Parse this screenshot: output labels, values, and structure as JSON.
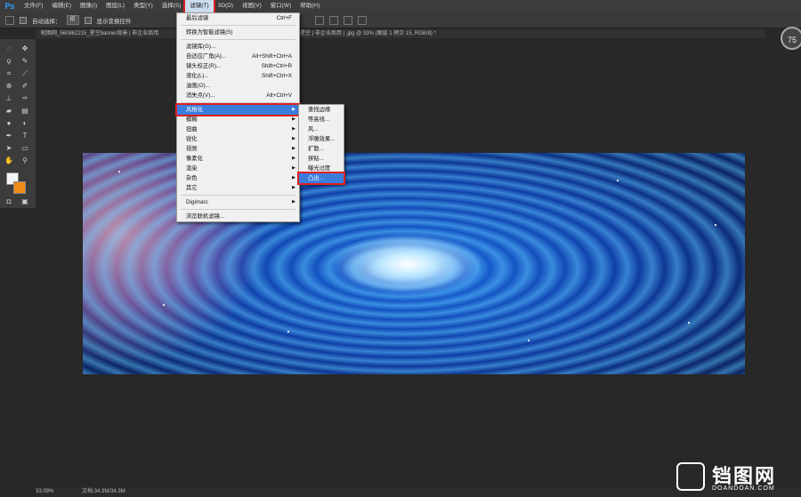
{
  "menubar": {
    "logo": "Ps",
    "items": [
      {
        "label": "文件(F)"
      },
      {
        "label": "编辑(E)"
      },
      {
        "label": "图像(I)"
      },
      {
        "label": "图层(L)"
      },
      {
        "label": "类型(Y)"
      },
      {
        "label": "选择(S)"
      },
      {
        "label": "滤镜(T)",
        "active": true
      },
      {
        "label": "3D(D)"
      },
      {
        "label": "视图(V)"
      },
      {
        "label": "窗口(W)"
      },
      {
        "label": "帮助(H)"
      }
    ]
  },
  "options": {
    "auto_select_label": "自动选择：",
    "auto_select_value": "组",
    "show_transform_label": "显示变换控件"
  },
  "document_tab": {
    "left_title": "昵图网_560862215_星空banner背景 | 非企业商用",
    "right_title": "梦幻星空 | 非企业商用 | .jpg @ 33% (图层 1 拷贝 15, RGB/8) *"
  },
  "zoom_badge": "75",
  "filter_menu": {
    "items": [
      {
        "label": "最后滤镜",
        "shortcut": "Ctrl+F"
      },
      {
        "sep": true
      },
      {
        "label": "转换为智能滤镜(S)"
      },
      {
        "sep": true
      },
      {
        "label": "滤镜库(G)..."
      },
      {
        "label": "自适应广角(A)...",
        "shortcut": "Alt+Shift+Ctrl+A"
      },
      {
        "label": "镜头校正(R)...",
        "shortcut": "Shift+Ctrl+R"
      },
      {
        "label": "液化(L)...",
        "shortcut": "Shift+Ctrl+X"
      },
      {
        "label": "油画(O)..."
      },
      {
        "label": "消失点(V)...",
        "shortcut": "Alt+Ctrl+V"
      },
      {
        "sep": true
      },
      {
        "label": "风格化",
        "submenu": true,
        "highlighted": true
      },
      {
        "label": "模糊",
        "submenu": true
      },
      {
        "label": "扭曲",
        "submenu": true
      },
      {
        "label": "锐化",
        "submenu": true
      },
      {
        "label": "视频",
        "submenu": true
      },
      {
        "label": "像素化",
        "submenu": true
      },
      {
        "label": "渲染",
        "submenu": true
      },
      {
        "label": "杂色",
        "submenu": true
      },
      {
        "label": "其它",
        "submenu": true
      },
      {
        "sep": true
      },
      {
        "label": "Digimarc",
        "submenu": true
      },
      {
        "sep": true
      },
      {
        "label": "浏览联机滤镜..."
      }
    ]
  },
  "stylize_submenu": {
    "items": [
      {
        "label": "查找边缘"
      },
      {
        "label": "等高线..."
      },
      {
        "label": "风..."
      },
      {
        "label": "浮雕效果..."
      },
      {
        "label": "扩散..."
      },
      {
        "label": "拼贴..."
      },
      {
        "label": "曝光过度"
      },
      {
        "label": "凸出...",
        "highlighted": true
      }
    ]
  },
  "status": {
    "zoom": "33.09%",
    "doc": "文档:34.3M/34.3M"
  },
  "watermark": {
    "text": "铛图网",
    "sub": "DOANDOAN.COM"
  },
  "colors": {
    "foreground": "#f5f5f5",
    "background": "#f08c1a",
    "highlight": "#3b7ddc",
    "callout": "#e02020"
  }
}
